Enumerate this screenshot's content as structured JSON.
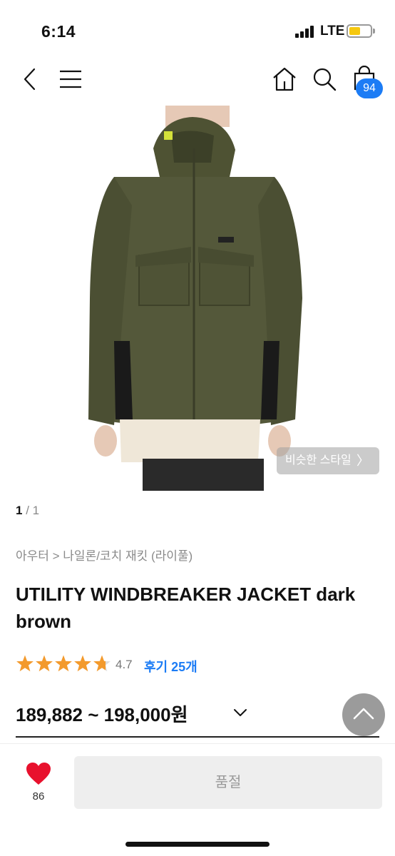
{
  "status_bar": {
    "time": "6:14",
    "network": "LTE",
    "battery_level_fraction": 0.55,
    "battery_color": "#f6c80f"
  },
  "nav": {
    "icons": [
      "back-icon",
      "menu-icon",
      "home-icon",
      "search-icon",
      "shopping-bag-icon"
    ],
    "cart_count": "94",
    "badge_color": "#1c7cf5"
  },
  "gallery": {
    "similar_style_label": "비슷한 스타일",
    "similar_style_chevron": "〉",
    "pager_current": "1",
    "pager_rest": " / 1"
  },
  "product": {
    "breadcrumb": "아우터 > 나일론/코치 재킷 (라이풀)",
    "title": "UTILITY WINDBREAKER JACKET dark brown",
    "rating": 4.7,
    "rating_text": "4.7",
    "review_link": "후기 25개",
    "star_color": "#f39a2c",
    "price": "189,882 ~ 198,000원"
  },
  "bottom_bar": {
    "like_count": "86",
    "like_color": "#e8112d",
    "soldout_label": "품절"
  }
}
